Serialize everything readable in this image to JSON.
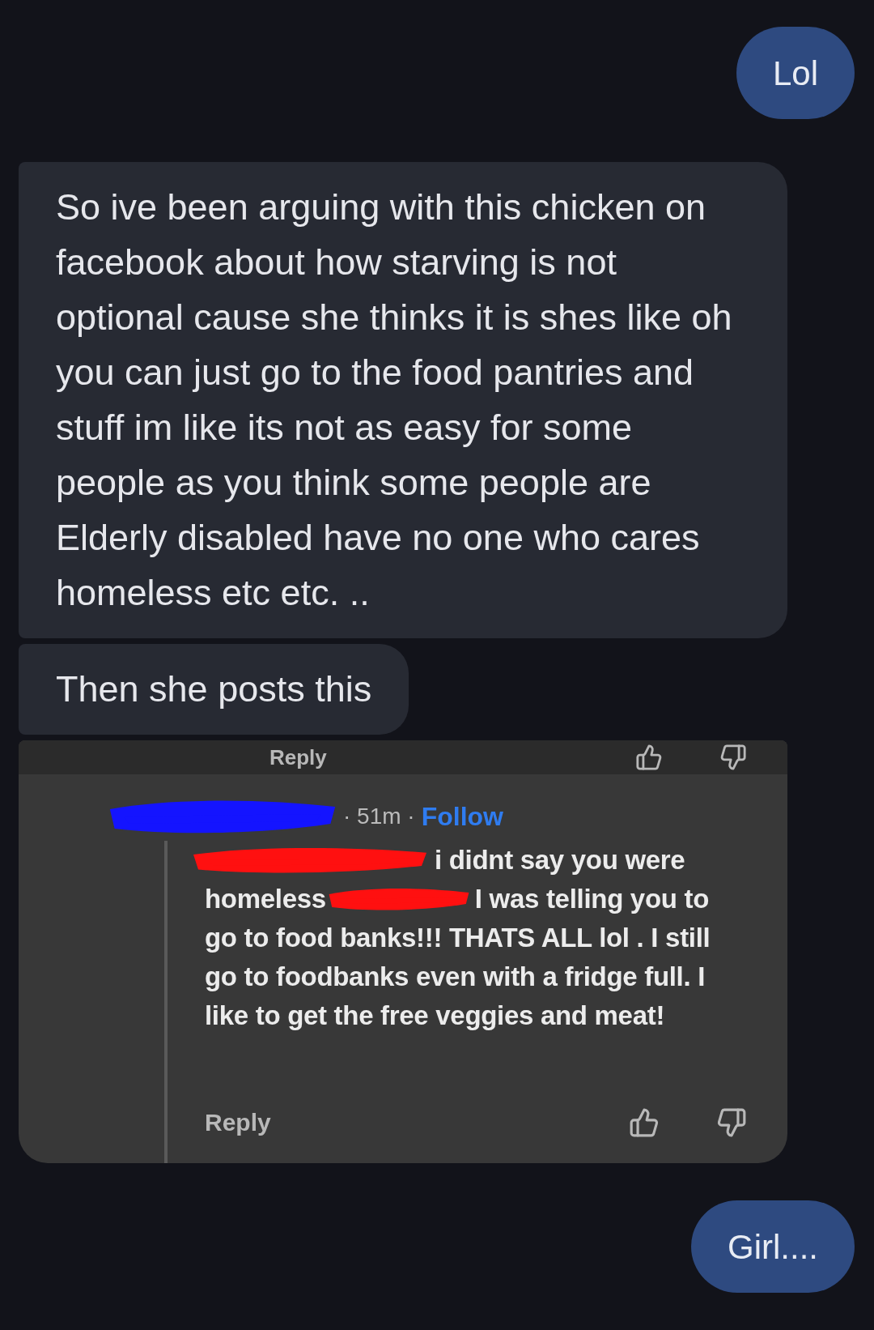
{
  "messages": [
    {
      "kind": "sent",
      "text": "Lol"
    },
    {
      "kind": "received",
      "text": "So ive been arguing with this chicken on facebook about how starving is not optional cause she thinks it is shes like oh you can just go to the food pantries and stuff im like its not as easy for some people as you think some people are Elderly disabled have no one who cares homeless etc etc. .."
    },
    {
      "kind": "received",
      "text": "Then she posts this"
    },
    {
      "kind": "image",
      "top_reply": "Reply",
      "time": "· 51m ·",
      "follow": "Follow",
      "segments": [
        "i didnt say you were",
        "homeless",
        "I was telling you to",
        "go to food banks!!! THATS ALL lol . I still go to foodbanks even with a fridge full. I like to get the free veggies and meat!"
      ],
      "reply": "Reply"
    },
    {
      "kind": "sent",
      "text": "Girl...."
    }
  ]
}
